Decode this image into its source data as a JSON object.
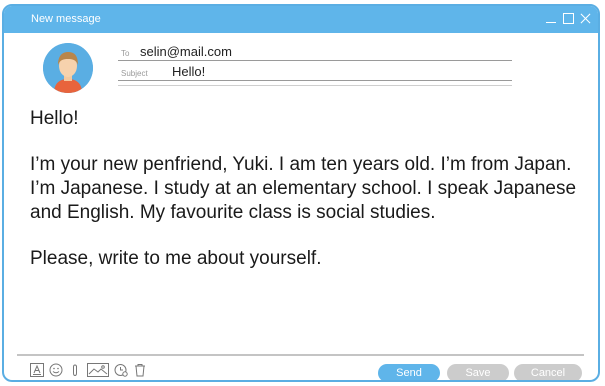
{
  "window": {
    "title": "New message"
  },
  "compose": {
    "to_label": "To",
    "to_value": "selin@mail.com",
    "subject_label": "Subject",
    "subject_value": "Hello!"
  },
  "message": {
    "greeting": "Hello!",
    "body": "I’m your new penfriend, Yuki. I am ten years old. I’m from Japan. I’m Japanese. I study at an elementary school. I speak Japanese and English. My favourite class is social studies.",
    "closing": "Please, write to me about yourself."
  },
  "toolbar": {
    "icons": [
      "text-format-icon",
      "emoji-icon",
      "attachment-icon",
      "image-icon",
      "schedule-icon",
      "trash-icon"
    ]
  },
  "buttons": {
    "send": "Send",
    "save": "Save",
    "cancel": "Cancel"
  },
  "colors": {
    "accent": "#5fb5ea",
    "disabled": "#cccccc"
  }
}
